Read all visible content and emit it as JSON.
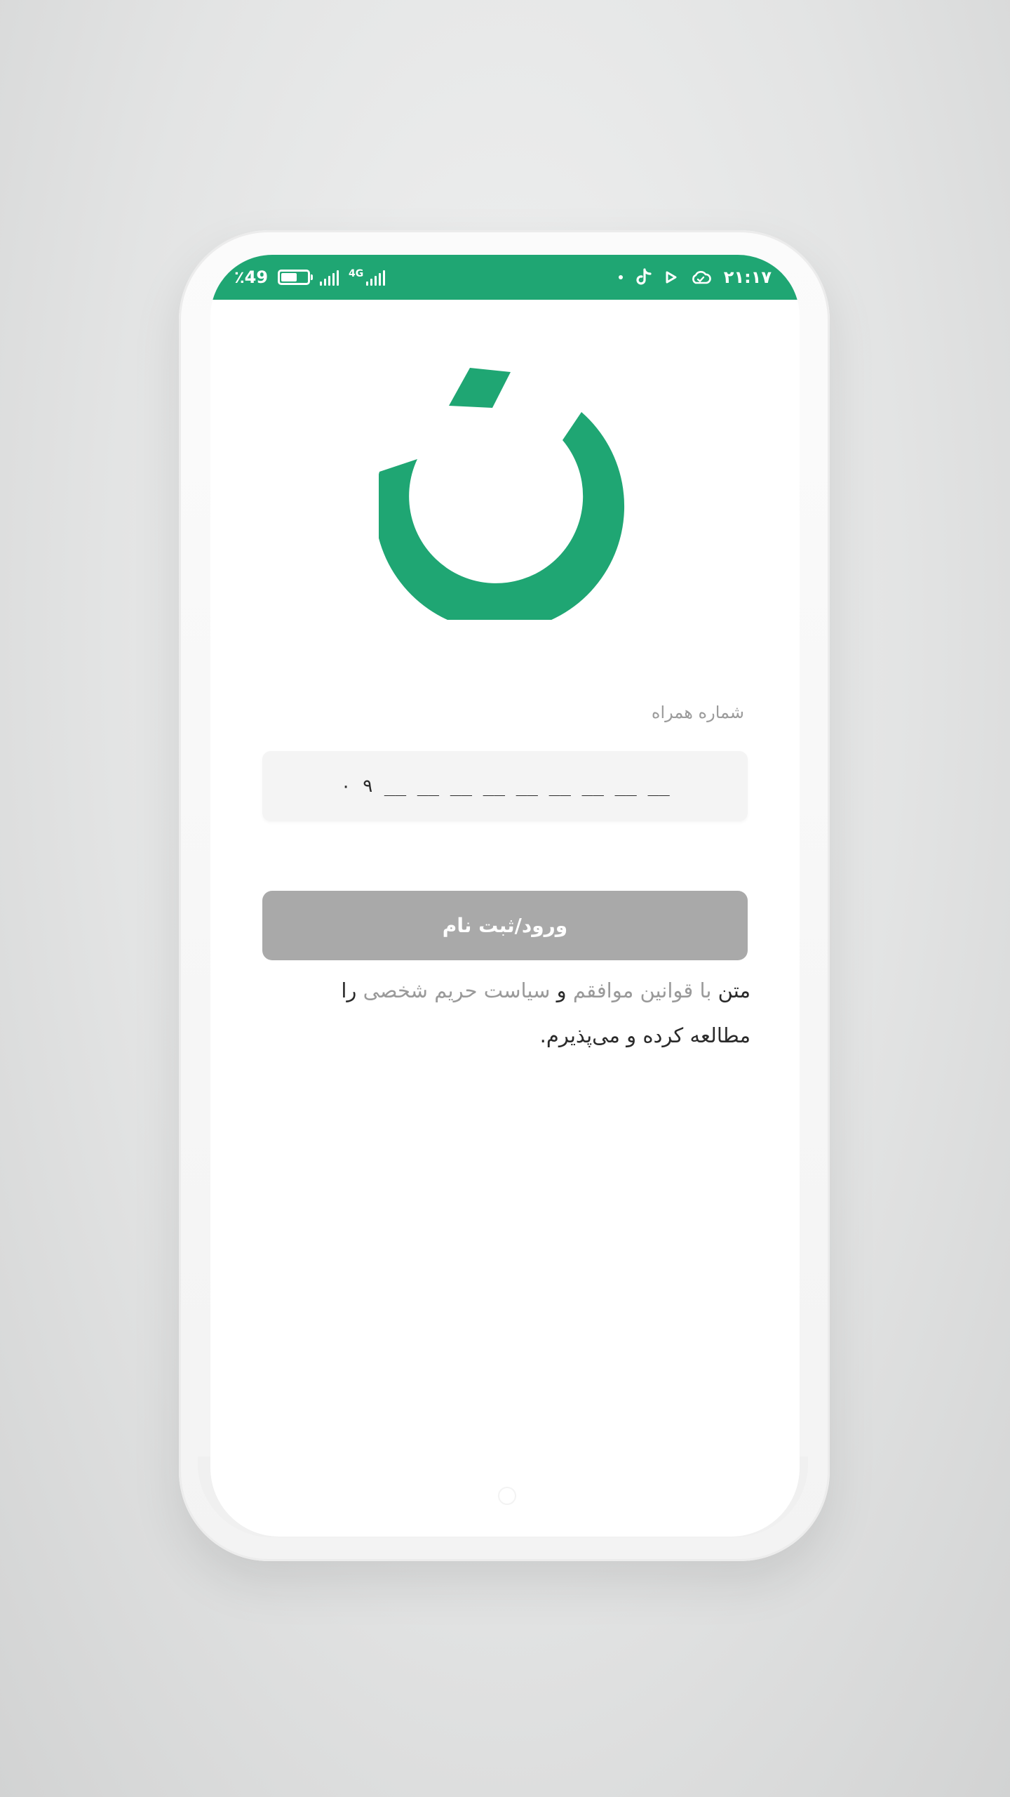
{
  "status_bar": {
    "battery_percent": "٪49",
    "network_type": "4G",
    "time": "۲۱:۱۷",
    "icons": [
      "battery-icon",
      "signal-icon",
      "signal-4g-icon",
      "dot-icon",
      "tiktok-icon",
      "play-icon",
      "cloud-icon"
    ]
  },
  "colors": {
    "brand_green": "#1fa673",
    "button_disabled": "#a9a9a9",
    "link_gray": "#9a9a9a"
  },
  "form": {
    "phone_label": "شماره همراه",
    "phone_placeholder": "۰ ۹ __ __ __ __ __ __ __ __ __",
    "submit_label": "ورود/ثبت نام"
  },
  "terms": {
    "part1": "متن ",
    "part2": "با قوانین موافقم",
    "part3": " و ",
    "part4": "سیاست حریم شخصی",
    "part5": " را مطالعه کرده و می‌پذیرم."
  }
}
